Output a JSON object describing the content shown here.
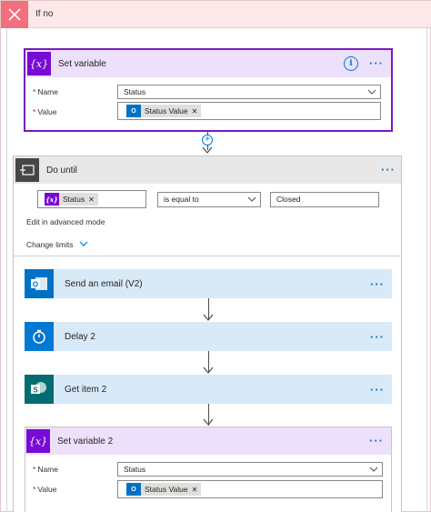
{
  "branch": {
    "title": "If no"
  },
  "set_variable": {
    "title": "Set variable",
    "name_label": "Name",
    "name_value": "Status",
    "value_label": "Value",
    "value_token": "Status Value"
  },
  "do_until": {
    "title": "Do until",
    "condition_token": "Status",
    "operator": "is equal to",
    "compare_value": "Closed",
    "advanced_link": "Edit in advanced mode",
    "change_limits": "Change limits"
  },
  "actions": [
    {
      "title": "Send an email (V2)",
      "icon": "outlook-icon",
      "color": "#0072c6"
    },
    {
      "title": "Delay 2",
      "icon": "timer-icon",
      "color": "#0078d4"
    },
    {
      "title": "Get item 2",
      "icon": "sharepoint-icon",
      "color": "#036c70"
    }
  ],
  "set_variable_2": {
    "title": "Set variable 2",
    "name_label": "Name",
    "name_value": "Status",
    "value_label": "Value",
    "value_token": "Status Value"
  },
  "colors": {
    "variable_purple": "#770bd6",
    "accent_blue": "#0078d4",
    "branch_red": "#f1707b",
    "action_bg": "#d8e9f8"
  }
}
